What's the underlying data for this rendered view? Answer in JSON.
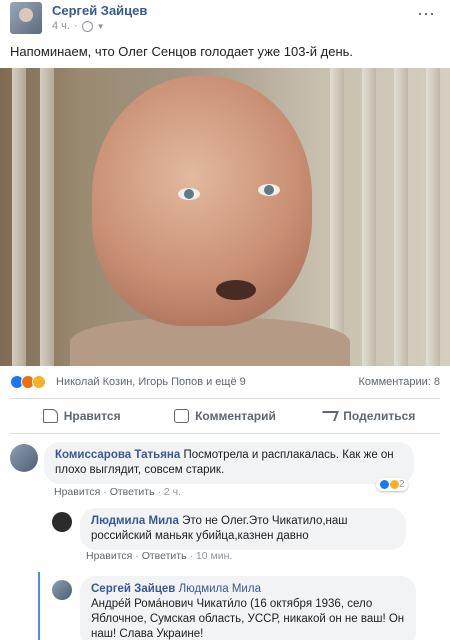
{
  "post": {
    "author": "Сергей Зайцев",
    "time": "4 ч.",
    "more_icon": "⋯",
    "text": "Напоминаем, что Олег Сенцов голодает уже 103-й день."
  },
  "reactions": {
    "names": "Николай Козин, Игорь Попов и ещё 9",
    "comments": "Комментарии: 8",
    "colors": {
      "like": "#1877f2",
      "angry": "#e9710f",
      "sad": "#f7b125"
    }
  },
  "actions": {
    "like": "Нравится",
    "comment": "Комментарий",
    "share": "Поделиться"
  },
  "comments": [
    {
      "author": "Комиссарова Татьяна",
      "text": "Посмотрела и расплакалась. Как же он плохо выглядит, совсем старик.",
      "like": "Нравится",
      "reply": "Ответить",
      "time": "2 ч.",
      "reaction_count": "2"
    },
    {
      "author": "Людмила Мила",
      "text": "Это не Олег.Это Чикатило,наш российский маньяк убийца,казнен давно",
      "like": "Нравится",
      "reply": "Ответить",
      "time": "10 мин."
    },
    {
      "author": "Сергей Зайцев",
      "tag": "Людмила Мила",
      "text": "Андре́й Рома́нович Чикати́ло (16 октября 1936, село Яблочное, Сумская область, УССР, никакой он не ваш! Он наш! Слава Украине!"
    }
  ],
  "separator": "·",
  "brand_color": "#385898"
}
